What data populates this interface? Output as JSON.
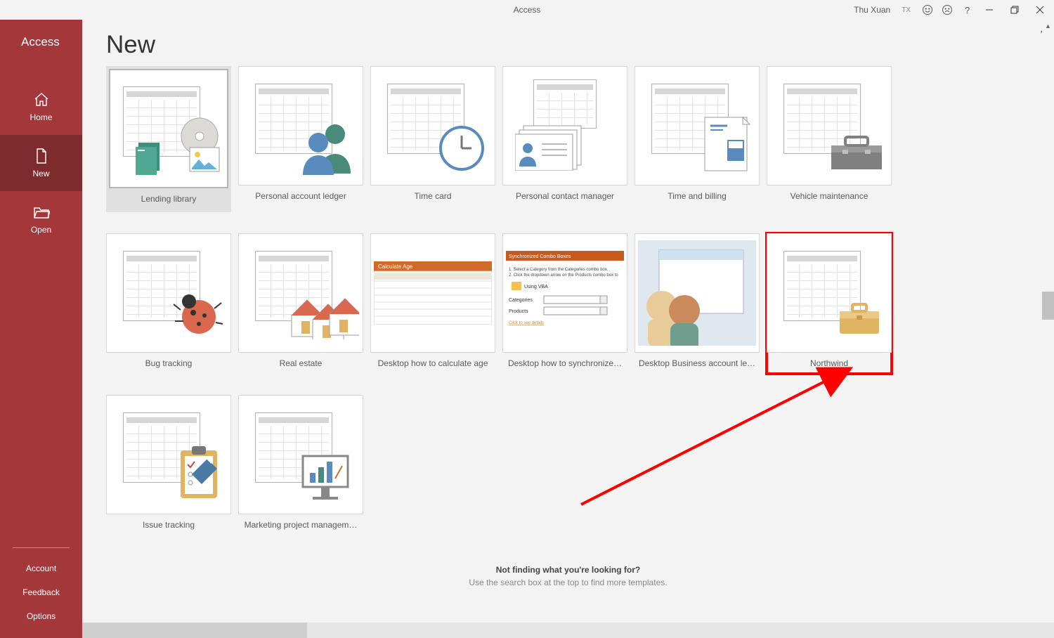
{
  "titlebar": {
    "app_title": "Access",
    "user_name": "Thu Xuan",
    "user_initials": "TX"
  },
  "sidebar": {
    "app_name": "Access",
    "nav": [
      {
        "id": "home",
        "label": "Home",
        "active": false
      },
      {
        "id": "new",
        "label": "New",
        "active": true
      },
      {
        "id": "open",
        "label": "Open",
        "active": false
      }
    ],
    "bottom_links": [
      {
        "id": "account",
        "label": "Account"
      },
      {
        "id": "feedback",
        "label": "Feedback"
      },
      {
        "id": "options",
        "label": "Options"
      }
    ]
  },
  "main": {
    "page_title": "New",
    "templates": [
      {
        "id": "lending-library",
        "label": "Lending library",
        "selected": true,
        "pinnable": true
      },
      {
        "id": "personal-ledger",
        "label": "Personal account ledger"
      },
      {
        "id": "time-card",
        "label": "Time card"
      },
      {
        "id": "personal-contact",
        "label": "Personal contact manager"
      },
      {
        "id": "time-billing",
        "label": "Time and billing"
      },
      {
        "id": "vehicle-maint",
        "label": "Vehicle maintenance"
      },
      {
        "id": "bug-tracking",
        "label": "Bug tracking"
      },
      {
        "id": "real-estate",
        "label": "Real estate"
      },
      {
        "id": "calc-age",
        "label": "Desktop how to calculate age"
      },
      {
        "id": "sync-combo",
        "label": "Desktop how to synchronize…"
      },
      {
        "id": "biz-account",
        "label": "Desktop Business account le…"
      },
      {
        "id": "northwind",
        "label": "Northwind",
        "highlighted": true
      },
      {
        "id": "issue-tracking",
        "label": "Issue tracking"
      },
      {
        "id": "marketing",
        "label": "Marketing project managem…"
      }
    ],
    "footer": {
      "line1": "Not finding what you're looking for?",
      "line2": "Use the search box at the top to find more templates."
    }
  }
}
